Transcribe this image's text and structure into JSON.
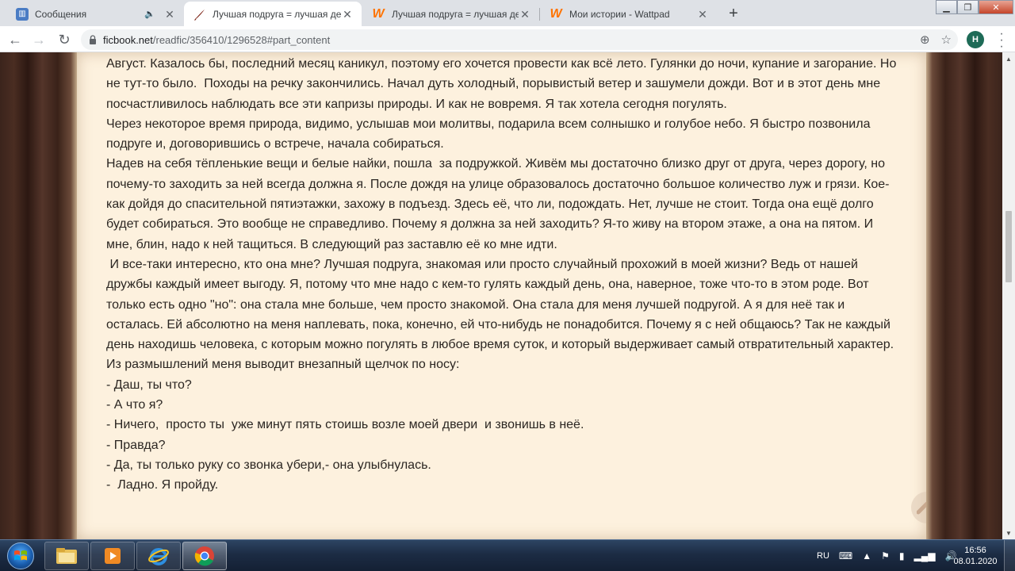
{
  "browser": {
    "tabs": [
      {
        "title": "Сообщения",
        "favicon": "messages-favicon",
        "extra": "🔈"
      },
      {
        "title": "Лучшая подруга = лучшая девуш",
        "favicon": "ficbook-favicon",
        "active": true
      },
      {
        "title": "Лучшая подруга = лучшая девуш",
        "favicon": "wattpad-favicon"
      },
      {
        "title": "Мои истории - Wattpad",
        "favicon": "wattpad-favicon"
      }
    ],
    "url_host": "ficbook.net",
    "url_path": "/readfic/356410/1296528#part_content",
    "profile_initial": "H"
  },
  "story": {
    "paragraphs": [
      "Август. Казалось бы, последний месяц каникул, поэтому его хочется провести как всё лето. Гулянки до ночи, купание и загорание. Но не тут-то было.  Походы на речку закончились. Начал дуть холодный, порывистый ветер и зашумели дожди. Вот и в этот день мне посчастливилось наблюдать все эти капризы природы. И как не вовремя. Я так хотела сегодня погулять.",
      "Через некоторое время природа, видимо, услышав мои молитвы, подарила всем солнышко и голубое небо. Я быстро позвонила подруге и, договорившись о встрече, начала собираться.",
      "Надев на себя тёпленькие вещи и белые найки, пошла  за подружкой. Живём мы достаточно близко друг от друга, через дорогу, но  почему-то заходить за ней всегда должна я. После дождя на улице образовалось достаточно большое количество луж и грязи. Кое-как дойдя до спасительной пятиэтажки, захожу в подъезд. Здесь её, что ли, подождать. Нет, лучше не стоит. Тогда она ещё долго будет собираться. Это вообще не справедливо. Почему я должна за ней заходить? Я-то живу на втором этаже, а она на пятом. И мне, блин, надо к ней тащиться. В следующий раз заставлю её ко мне идти.",
      " И все-таки интересно, кто она мне? Лучшая подруга, знакомая или просто случайный прохожий в моей жизни? Ведь от нашей дружбы каждый имеет выгоду. Я, потому что мне надо с кем-то гулять каждый день, она, наверное, тоже что-то в этом роде. Вот только есть одно \"но\": она стала мне больше, чем просто знакомой. Она стала для меня лучшей подругой. А я для неё так и осталась. Ей абсолютно на меня наплевать, пока, конечно, ей что-нибудь не понадобится. Почему я с ней общаюсь? Так не каждый день находишь человека, с которым можно погулять в любое время суток, и который выдерживает самый отвратительный характер.",
      "Из размышлений меня выводит внезапный щелчок по носу:",
      "- Даш, ты что?",
      "- А что я?",
      "- Ничего,  просто ты  уже минут пять стоишь возле моей двери  и звонишь в неё.",
      "- Правда?",
      "- Да, ты только руку со звонка убери,- она улыбнулась.",
      "-  Ладно. Я пройду."
    ]
  },
  "taskbar": {
    "lang": "RU",
    "time": "16:56",
    "date": "08.01.2020"
  }
}
